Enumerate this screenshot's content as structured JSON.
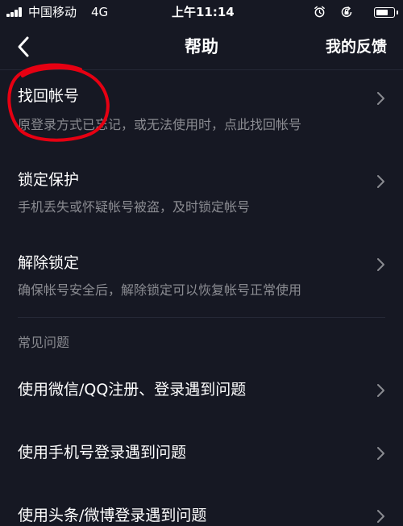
{
  "status_bar": {
    "carrier": "中国移动",
    "network": "4G",
    "time": "上午11:14",
    "battery_level": 0.85
  },
  "nav": {
    "title": "帮助",
    "feedback": "我的反馈"
  },
  "items": [
    {
      "title": "找回帐号",
      "desc": "原登录方式已忘记，或无法使用时，点此找回帐号"
    },
    {
      "title": "锁定保护",
      "desc": "手机丢失或怀疑帐号被盗，及时锁定帐号"
    },
    {
      "title": "解除锁定",
      "desc": "确保帐号安全后，解除锁定可以恢复帐号正常使用"
    }
  ],
  "faq": {
    "header": "常见问题",
    "items": [
      {
        "title": "使用微信/QQ注册、登录遇到问题"
      },
      {
        "title": "使用手机号登录遇到问题"
      },
      {
        "title": "使用头条/微博登录遇到问题"
      }
    ]
  },
  "colors": {
    "background": "#161823",
    "annotation": "#e60012",
    "secondary_text": "#8a8b91"
  }
}
